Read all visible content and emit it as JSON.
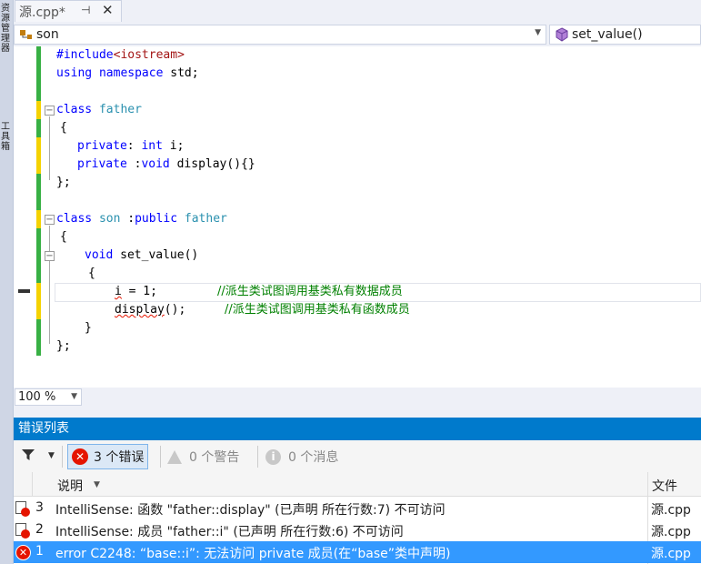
{
  "left_strip": {
    "text_top": "资源管理器",
    "text_bottom": "工具箱"
  },
  "tab": {
    "title": "源.cpp*",
    "pin_glyph": "⊣",
    "close_glyph": "✕"
  },
  "nav": {
    "scope": "son",
    "member": "set_value()"
  },
  "code": {
    "l1_kw": "#include",
    "l1_inc": "<iostream>",
    "l2_kw1": "using",
    "l2_kw2": "namespace",
    "l2_rest": " std;",
    "l4_kw": "class",
    "l4_ty": "father",
    "l5": "{",
    "l6_kw1": "private",
    "l6_mid": ": ",
    "l6_kw2": "int",
    "l6_rest": " i;",
    "l7_kw1": "private",
    "l7_mid": " :",
    "l7_kw2": "void",
    "l7_rest": " display(){}",
    "l8": "};",
    "l10_kw": "class",
    "l10_ty1": "son",
    "l10_mid": " :",
    "l10_kw2": "public",
    "l10_ty2": "father",
    "l11": "{",
    "l12_kw": "void",
    "l12_rest": " set_value()",
    "l13": "{",
    "l14_var": "i",
    "l14_rest": " = 1;",
    "l14_comment": "//派生类试图调用基类私有数据成员",
    "l15_fn": "display",
    "l15_rest": "();",
    "l15_comment": "//派生类试图调用基类私有函数成员",
    "l16": "}",
    "l17": "};"
  },
  "zoom": {
    "value": "100 %"
  },
  "error_list": {
    "title": "错误列表",
    "errors_label": "3 个错误",
    "warnings_label": "0 个警告",
    "messages_label": "0 个消息",
    "col_desc": "说明",
    "col_file": "文件",
    "rows": [
      {
        "num": "3",
        "desc": "IntelliSense: 函数 \"father::display\" (已声明 所在行数:7) 不可访问",
        "file": "源.cpp"
      },
      {
        "num": "2",
        "desc": "IntelliSense: 成员 \"father::i\" (已声明 所在行数:6) 不可访问",
        "file": "源.cpp"
      },
      {
        "num": "1",
        "desc": "error C2248: “base::i”: 无法访问 private 成员(在“base”类中声明)",
        "file": "源.cpp"
      }
    ]
  },
  "colors": {
    "accent": "#007acc",
    "selection": "#3399ff",
    "error_red": "#e51400",
    "keyword_blue": "#0000ff",
    "type_teal": "#2b91af",
    "comment_green": "#008000",
    "change_green": "#38b044",
    "change_yellow": "#f5d200"
  }
}
